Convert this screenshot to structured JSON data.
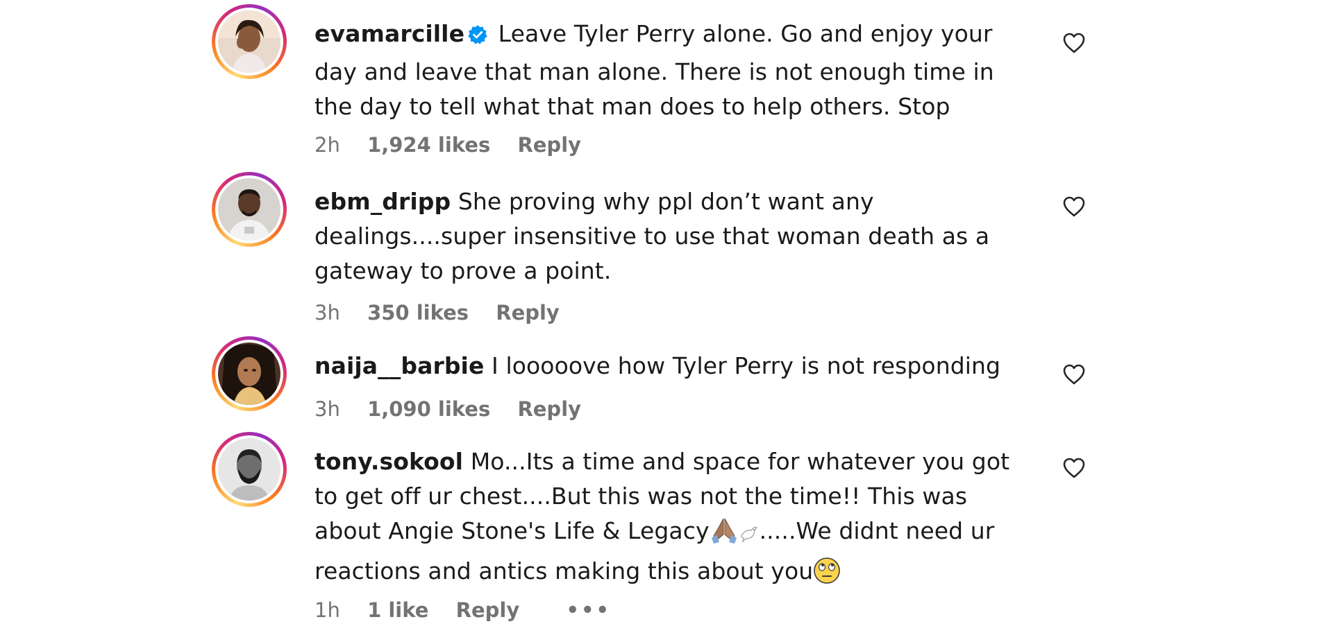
{
  "comments": [
    {
      "username": "evamarcille",
      "verified": true,
      "text": "Leave Tyler Perry alone. Go and enjoy your day and leave that man alone. There is not enough time in the day to tell what that man does to help others. Stop",
      "time": "2h",
      "likes": "1,924 likes",
      "reply": "Reply"
    },
    {
      "username": "ebm_dripp",
      "verified": false,
      "text": "She proving why ppl don’t want any dealings....super insensitive to use that woman death as a gateway to prove a point.",
      "time": "3h",
      "likes": "350 likes",
      "reply": "Reply"
    },
    {
      "username": "naija__barbie",
      "verified": false,
      "text": "I looooove how Tyler Perry is not responding",
      "time": "3h",
      "likes": "1,090 likes",
      "reply": "Reply"
    },
    {
      "username": "tony.sokool",
      "verified": false,
      "text_part1": "Mo...Its a time and space for whatever you got to get off ur chest....But this was not the time!! This was about Angie Stone's Life & Legacy",
      "text_part2": ".....We didnt need ur reactions and antics making this about you",
      "time": "1h",
      "likes": "1 like",
      "reply": "Reply",
      "more": "•••"
    }
  ],
  "icons": {
    "verified": "verified-badge-icon",
    "like": "heart-outline-icon",
    "more": "more-options-icon"
  },
  "colors": {
    "verified_blue": "#0095f6",
    "meta_gray": "#737373",
    "text": "#1a1a1a"
  }
}
